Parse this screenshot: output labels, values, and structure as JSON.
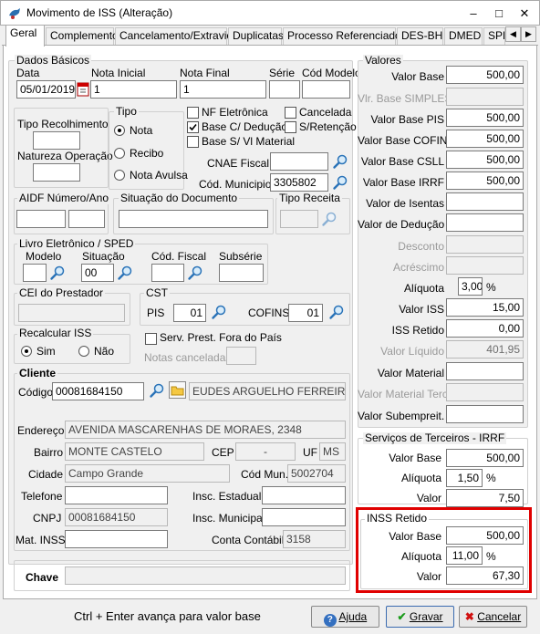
{
  "window": {
    "title": "Movimento de ISS (Alteração)",
    "minimize": "–",
    "maximize": "□",
    "close": "✕"
  },
  "tabs": [
    "Geral",
    "Complemento",
    "Cancelamento/Extravio",
    "Duplicatas",
    "Processo Referenciado",
    "DES-BH",
    "DMED",
    "SPE"
  ],
  "dados": {
    "title": "Dados Básicos",
    "data_label": "Data",
    "data_value": "05/01/2019",
    "nota_inicial_label": "Nota Inicial",
    "nota_inicial_value": "1",
    "nota_final_label": "Nota Final",
    "nota_final_value": "1",
    "serie_label": "Série",
    "serie_value": "",
    "cod_modelo_label": "Cód Modelo",
    "cod_modelo_value": "",
    "tipo_recolhimento_label": "Tipo Recolhimento",
    "natureza_label": "Natureza Operação",
    "tipo_title": "Tipo",
    "tipo_options": [
      "Nota",
      "Recibo",
      "Nota Avulsa"
    ],
    "checks": {
      "nf_eletronica": "NF Eletrônica",
      "cancelada": "Cancelada",
      "base_deducao": "Base C/ Dedução",
      "s_retencao": "S/Retenção",
      "base_vl_material": "Base S/ Vl Material"
    },
    "cnae_label": "CNAE Fiscal",
    "cod_municipio_label": "Cód. Municipio",
    "cod_municipio_value": "3305802"
  },
  "aidf": {
    "title": "AIDF Número/Ano",
    "situacao_title": "Situação do Documento",
    "tipo_receita_title": "Tipo Receita"
  },
  "livro": {
    "title": "Livro Eletrônico / SPED",
    "modelo_label": "Modelo",
    "situacao_label": "Situação",
    "situacao_value": "00",
    "cod_fiscal_label": "Cód. Fiscal",
    "subserie_label": "Subsérie"
  },
  "cei": {
    "title": "CEI do Prestador"
  },
  "cst": {
    "title": "CST",
    "pis_label": "PIS",
    "pis_value": "01",
    "cofins_label": "COFINS",
    "cofins_value": "01"
  },
  "recalc": {
    "title": "Recalcular ISS",
    "sim": "Sim",
    "nao": "Não"
  },
  "serv_prest": "Serv. Prest. Fora do País",
  "notas_canceladas_label": "Notas canceladas",
  "cliente": {
    "title": "Cliente",
    "codigo_label": "Código",
    "codigo_value": "00081684150",
    "nome_value": "EUDES ARGUELHO FERREIRA",
    "endereco_label": "Endereço",
    "endereco_value": "AVENIDA MASCARENHAS DE MORAES, 2348",
    "bairro_label": "Bairro",
    "bairro_value": "MONTE CASTELO",
    "cep_label": "CEP",
    "cep_value": "-",
    "uf_label": "UF",
    "uf_value": "MS",
    "cidade_label": "Cidade",
    "cidade_value": "Campo Grande",
    "cod_mun_label": "Cód Mun.",
    "cod_mun_value": "5002704",
    "telefone_label": "Telefone",
    "insc_estadual_label": "Insc. Estadual",
    "cnpj_label": "CNPJ",
    "cnpj_value": "00081684150",
    "insc_municipal_label": "Insc. Municipal",
    "mat_inss_label": "Mat. INSS",
    "conta_contabil_label": "Conta Contábil",
    "conta_contabil_value": "3158"
  },
  "chave_label": "Chave",
  "valores": {
    "title": "Valores",
    "rows": [
      {
        "label": "Valor Base",
        "value": "500,00",
        "disabled": false
      },
      {
        "label": "Vlr. Base SIMPLES",
        "value": "",
        "disabled": true
      },
      {
        "label": "Valor Base PIS",
        "value": "500,00",
        "disabled": false
      },
      {
        "label": "Valor Base COFINS",
        "value": "500,00",
        "disabled": false
      },
      {
        "label": "Valor Base CSLL",
        "value": "500,00",
        "disabled": false
      },
      {
        "label": "Valor Base IRRF",
        "value": "500,00",
        "disabled": false
      },
      {
        "label": "Valor de Isentas",
        "value": "",
        "disabled": false
      },
      {
        "label": "Valor de Dedução",
        "value": "",
        "disabled": false
      },
      {
        "label": "Desconto",
        "value": "",
        "disabled": true
      },
      {
        "label": "Acréscimo",
        "value": "",
        "disabled": true
      },
      {
        "label": "Alíquota",
        "value": "3,00",
        "disabled": false
      },
      {
        "label": "Valor ISS",
        "value": "15,00",
        "disabled": false
      },
      {
        "label": "ISS Retido",
        "value": "0,00",
        "disabled": false
      },
      {
        "label": "Valor Líquido",
        "value": "401,95",
        "disabled": true
      },
      {
        "label": "Valor Material",
        "value": "",
        "disabled": false
      },
      {
        "label": "Valor Material Terc.",
        "value": "",
        "disabled": true
      },
      {
        "label": "Valor Subempreit.",
        "value": "",
        "disabled": false
      }
    ],
    "pct": "%"
  },
  "irrf": {
    "title": "Serviços de Terceiros - IRRF",
    "base_label": "Valor Base",
    "base_value": "500,00",
    "aliq_label": "Alíquota",
    "aliq_value": "1,50",
    "valor_label": "Valor",
    "valor_value": "7,50"
  },
  "inss": {
    "title": "INSS Retido",
    "base_label": "Valor Base",
    "base_value": "500,00",
    "aliq_label": "Alíquota",
    "aliq_value": "11,00",
    "valor_label": "Valor",
    "valor_value": "67,30"
  },
  "footer": {
    "hint": "Ctrl + Enter avança para valor base",
    "ajuda": "Ajuda",
    "gravar": "Gravar",
    "cancelar": "Cancelar"
  },
  "colors": {
    "highlight": "#e00000",
    "title_bar": "#ffffff"
  }
}
